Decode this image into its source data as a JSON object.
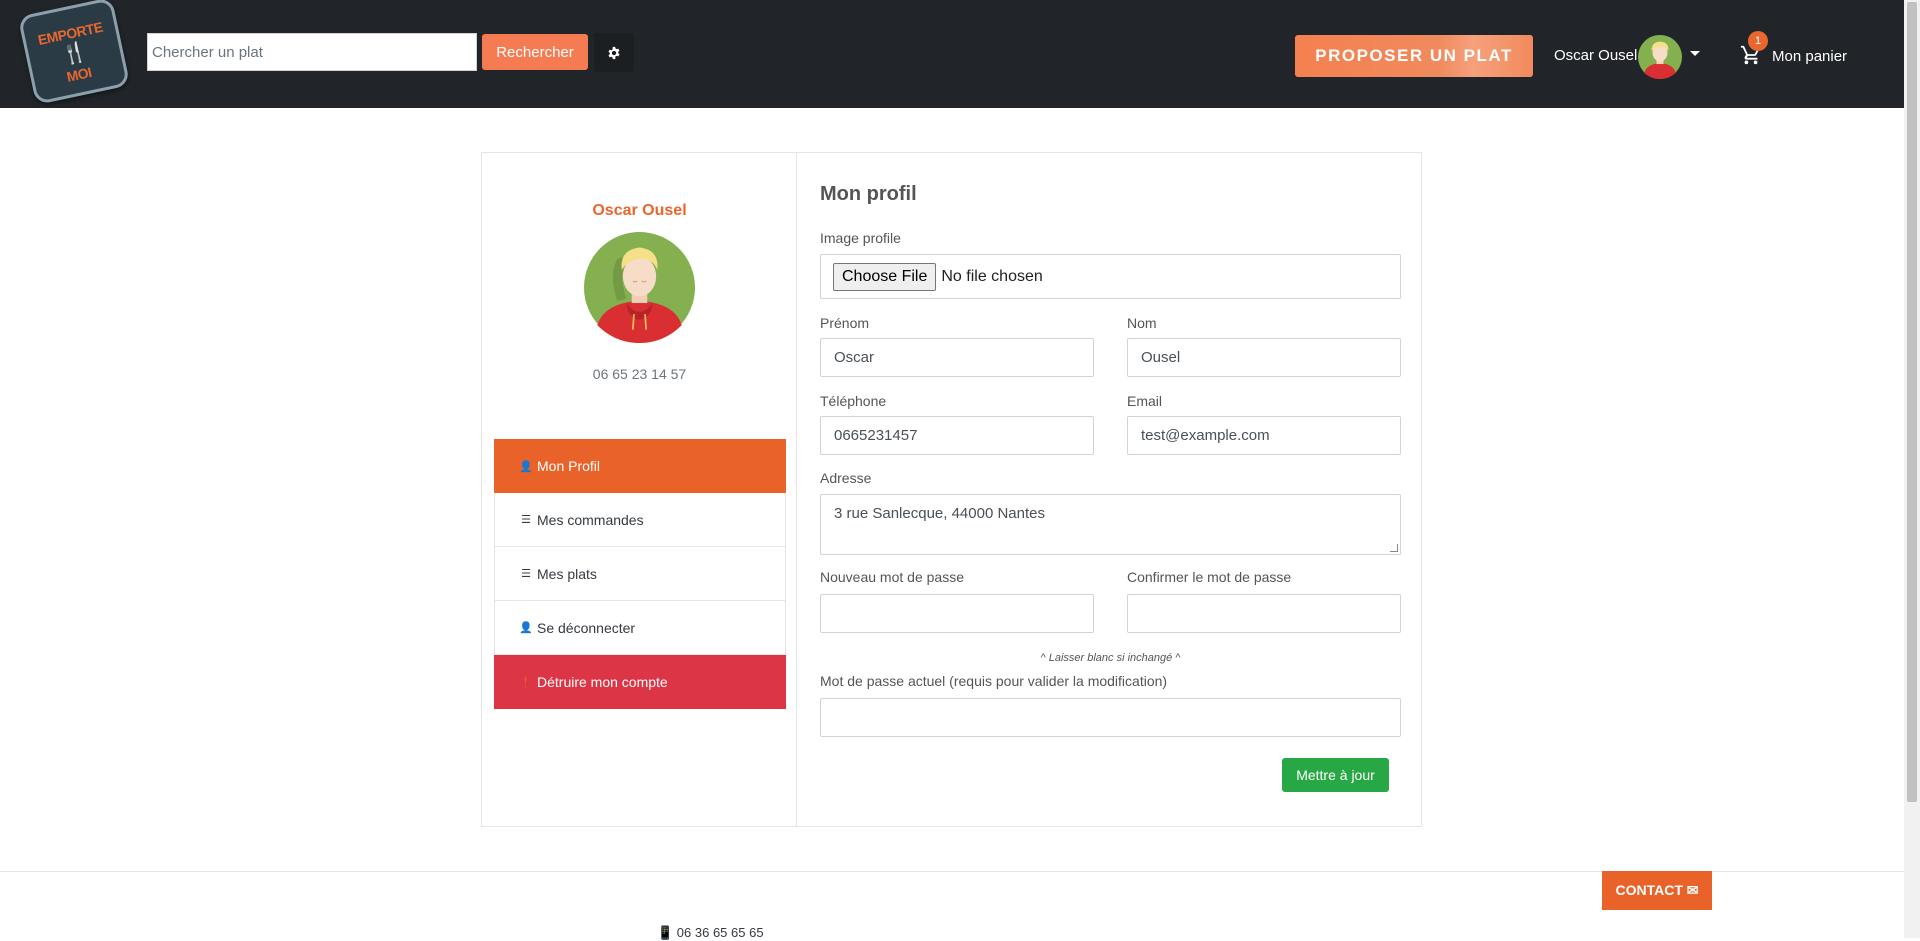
{
  "header": {
    "logo": {
      "line1": "EMPORTE",
      "line2": "🍴",
      "line3": "MOI"
    },
    "search_placeholder": "Chercher un plat",
    "search_button": "Rechercher",
    "propose_button": "PROPOSER UN PLAT",
    "user_name": "Oscar Ousel",
    "cart_count": "1",
    "cart_label": "Mon panier"
  },
  "profile": {
    "name": "Oscar Ousel",
    "phone": "06 65 23 14 57"
  },
  "menu": [
    {
      "label": "Mon Profil",
      "icon": "user-icon",
      "glyph": "👤"
    },
    {
      "label": "Mes commandes",
      "icon": "list-icon",
      "glyph": "☰"
    },
    {
      "label": "Mes plats",
      "icon": "list-icon",
      "glyph": "☰"
    },
    {
      "label": "Se déconnecter",
      "icon": "user-logout-icon",
      "glyph": "👤"
    },
    {
      "label": "Détruire mon compte",
      "icon": "alert-icon",
      "glyph": "❗"
    }
  ],
  "form": {
    "title": "Mon profil",
    "image_label": "Image profile",
    "file_button": "Choose File",
    "file_status": "No file chosen",
    "firstname_label": "Prénom",
    "firstname_value": "Oscar",
    "lastname_label": "Nom",
    "lastname_value": "Ousel",
    "phone_label": "Téléphone",
    "phone_value": "0665231457",
    "email_label": "Email",
    "email_value": "test@example.com",
    "address_label": "Adresse",
    "address_value": "3 rue Sanlecque, 44000 Nantes",
    "new_password_label": "Nouveau mot de passe",
    "confirm_password_label": "Confirmer le mot de passe",
    "hint": "^ Laisser blanc si inchangé ^",
    "current_password_label": "Mot de passe actuel (requis pour valider la modification)",
    "submit": "Mettre à jour"
  },
  "footer": {
    "contact_button": "CONTACT ✉",
    "phone": "📱 06 36 65 65 65"
  },
  "colors": {
    "header_bg": "#212529",
    "accent": "#e9622a",
    "danger": "#dc3545",
    "success": "#28a745"
  }
}
